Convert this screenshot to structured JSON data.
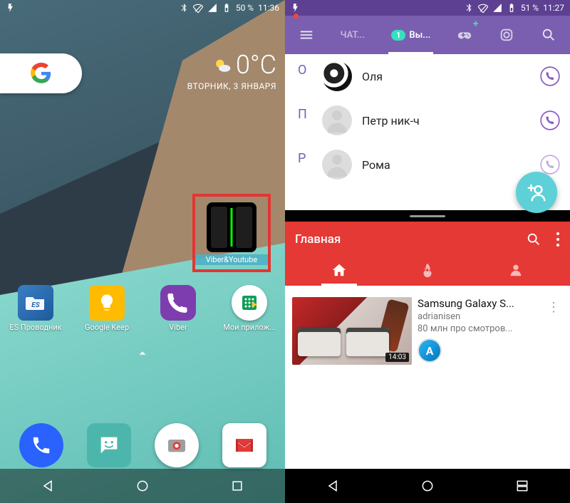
{
  "left": {
    "status": {
      "battery": "50 %",
      "time": "11:36"
    },
    "weather": {
      "temp": "0°C",
      "date": "ВТОРНИК, 3 ЯНВАРЯ"
    },
    "split_widget_label": "Viber&Youtube",
    "apps": [
      {
        "label": "ES Проводник"
      },
      {
        "label": "Google Keep"
      },
      {
        "label": "Viber"
      },
      {
        "label": "Мои прилож..."
      }
    ]
  },
  "right": {
    "status": {
      "battery": "51 %",
      "time": "11:27"
    },
    "viber_tabs": {
      "chat": "ЧАТ...",
      "contacts": "Вы...",
      "badge": "1"
    },
    "contact_sections": [
      {
        "letter": "О",
        "name": "Оля"
      },
      {
        "letter": "П",
        "name": "Петр ник-ч"
      },
      {
        "letter": "Р",
        "name": "Рома"
      }
    ],
    "youtube": {
      "header": "Главная",
      "video": {
        "duration": "14:03",
        "title": "Samsung Galaxy S...",
        "channel": "adrianisen",
        "views": "80 млн про смотров...",
        "avatar_letter": "A"
      }
    }
  }
}
